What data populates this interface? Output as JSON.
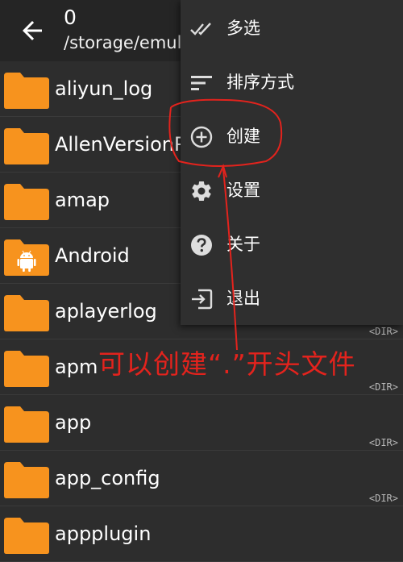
{
  "header": {
    "title": "0",
    "path": "/storage/emul"
  },
  "files": [
    {
      "name": "aliyun_log",
      "icon": "folder-icon",
      "tag": ""
    },
    {
      "name": "AllenVersionP",
      "icon": "folder-icon",
      "tag": ""
    },
    {
      "name": "amap",
      "icon": "folder-icon",
      "tag": ""
    },
    {
      "name": "Android",
      "icon": "android-folder-icon",
      "tag": ""
    },
    {
      "name": "aplayerlog",
      "icon": "folder-icon",
      "tag": "<DIR>"
    },
    {
      "name": "apm",
      "icon": "folder-icon",
      "tag": "<DIR>"
    },
    {
      "name": "app",
      "icon": "folder-icon",
      "tag": "<DIR>"
    },
    {
      "name": "app_config",
      "icon": "folder-icon",
      "tag": "<DIR>"
    },
    {
      "name": "appplugin",
      "icon": "folder-icon",
      "tag": ""
    }
  ],
  "menu": {
    "items": [
      {
        "label": "多选",
        "icon": "double-check-icon"
      },
      {
        "label": "排序方式",
        "icon": "sort-icon"
      },
      {
        "label": "创建",
        "icon": "add-circle-icon"
      },
      {
        "label": "设置",
        "icon": "gear-icon"
      },
      {
        "label": "关于",
        "icon": "help-icon"
      },
      {
        "label": "退出",
        "icon": "exit-icon"
      }
    ]
  },
  "annotation": {
    "text": "可以创建“.”开头文件",
    "color": "#e3231d"
  },
  "colors": {
    "folder": "#f7931e",
    "background": "#2d2d2d",
    "header": "#252525",
    "menu": "#2f2f2f"
  }
}
